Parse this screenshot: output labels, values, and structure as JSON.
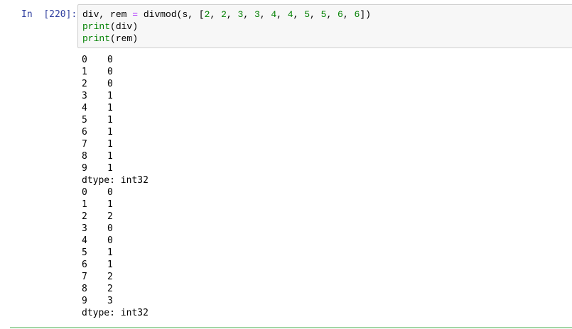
{
  "cell": {
    "prompt_label": "In",
    "prompt_number": "[220]:",
    "code_lines": [
      [
        {
          "t": "div",
          "c": "name"
        },
        {
          "t": ", ",
          "c": "name"
        },
        {
          "t": "rem",
          "c": "name"
        },
        {
          "t": " ",
          "c": "name"
        },
        {
          "t": "=",
          "c": "op"
        },
        {
          "t": " divmod(s, [",
          "c": "name"
        },
        {
          "t": "2",
          "c": "num"
        },
        {
          "t": ", ",
          "c": "name"
        },
        {
          "t": "2",
          "c": "num"
        },
        {
          "t": ", ",
          "c": "name"
        },
        {
          "t": "3",
          "c": "num"
        },
        {
          "t": ", ",
          "c": "name"
        },
        {
          "t": "3",
          "c": "num"
        },
        {
          "t": ", ",
          "c": "name"
        },
        {
          "t": "4",
          "c": "num"
        },
        {
          "t": ", ",
          "c": "name"
        },
        {
          "t": "4",
          "c": "num"
        },
        {
          "t": ", ",
          "c": "name"
        },
        {
          "t": "5",
          "c": "num"
        },
        {
          "t": ", ",
          "c": "name"
        },
        {
          "t": "5",
          "c": "num"
        },
        {
          "t": ", ",
          "c": "name"
        },
        {
          "t": "6",
          "c": "num"
        },
        {
          "t": ", ",
          "c": "name"
        },
        {
          "t": "6",
          "c": "num"
        },
        {
          "t": "])",
          "c": "name"
        }
      ],
      [
        {
          "t": "print",
          "c": "builtin"
        },
        {
          "t": "(div)",
          "c": "name"
        }
      ],
      [
        {
          "t": "print",
          "c": "builtin"
        },
        {
          "t": "(rem)",
          "c": "name"
        }
      ]
    ]
  },
  "outputs": {
    "div": {
      "rows": [
        {
          "index": "0",
          "value": "0"
        },
        {
          "index": "1",
          "value": "0"
        },
        {
          "index": "2",
          "value": "0"
        },
        {
          "index": "3",
          "value": "1"
        },
        {
          "index": "4",
          "value": "1"
        },
        {
          "index": "5",
          "value": "1"
        },
        {
          "index": "6",
          "value": "1"
        },
        {
          "index": "7",
          "value": "1"
        },
        {
          "index": "8",
          "value": "1"
        },
        {
          "index": "9",
          "value": "1"
        }
      ],
      "dtype": "dtype: int32"
    },
    "rem": {
      "rows": [
        {
          "index": "0",
          "value": "0"
        },
        {
          "index": "1",
          "value": "1"
        },
        {
          "index": "2",
          "value": "2"
        },
        {
          "index": "3",
          "value": "0"
        },
        {
          "index": "4",
          "value": "0"
        },
        {
          "index": "5",
          "value": "1"
        },
        {
          "index": "6",
          "value": "1"
        },
        {
          "index": "7",
          "value": "2"
        },
        {
          "index": "8",
          "value": "2"
        },
        {
          "index": "9",
          "value": "3"
        }
      ],
      "dtype": "dtype: int32"
    }
  },
  "colors": {
    "prompt": "#303f9f",
    "input_bg": "#f7f7f7",
    "input_border": "#cfcfcf",
    "operator": "#aa22ff",
    "builtin": "#008000",
    "number": "#008000",
    "cell_border_active": "#66bb6a"
  }
}
